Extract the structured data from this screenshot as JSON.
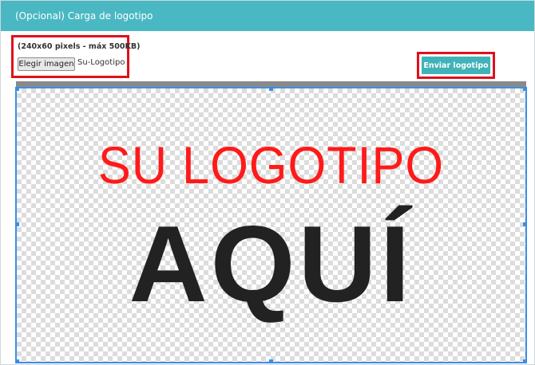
{
  "header": {
    "title": "(Opcional) Carga de logotipo"
  },
  "upload": {
    "hint": "(240x60 pixels - máx 500KB)",
    "choose_label": "Elegir imagen",
    "file_name": "Su-Logotipo"
  },
  "actions": {
    "send_label": "Enviar logotipo"
  },
  "preview": {
    "line1": "SU LOGOTIPO",
    "line2": "AQUÍ"
  },
  "colors": {
    "header": "#4ab8c2",
    "button": "#3fb3b8",
    "highlight": "#e0101b",
    "selection": "#3b8fe6",
    "logo_red": "#ff1a1a",
    "logo_dark": "#222222"
  }
}
